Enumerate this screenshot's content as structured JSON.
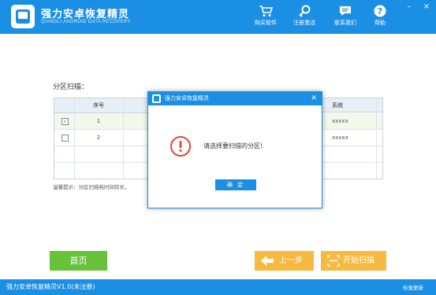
{
  "header": {
    "title": "强力安卓恢复精灵",
    "subtitle": "QIANGLI ANDROID DATA RECOVERY",
    "buttons": [
      {
        "label": "购买软件",
        "icon": "cart-icon"
      },
      {
        "label": "注册激活",
        "icon": "key-icon"
      },
      {
        "label": "联系我们",
        "icon": "chat-icon"
      },
      {
        "label": "帮助",
        "icon": "help-icon"
      }
    ],
    "window_controls": {
      "minimize": "–",
      "close": "×"
    }
  },
  "main": {
    "scan_label": "分区扫描：",
    "table": {
      "columns": [
        "序号",
        "系统"
      ],
      "rows": [
        {
          "checked": true,
          "index": "1",
          "system": "xxxxx"
        },
        {
          "checked": false,
          "index": "2",
          "system": "xxxxx"
        }
      ],
      "check_mark": "✓"
    },
    "tip": "温馨提示：分区扫描耗时间较长，"
  },
  "dialog": {
    "title": "强力安卓恢复精灵",
    "close": "×",
    "message": "请选择要扫描的分区!",
    "ok_label": "确 定"
  },
  "footer_buttons": {
    "home": "首页",
    "prev": "上一步",
    "start": "开始扫描"
  },
  "status_bar": {
    "text": "强力安卓恢复精灵V1.0(未注册)",
    "update": "检查更新"
  },
  "colors": {
    "primary": "#1a8fe4",
    "green": "#67c23a",
    "orange": "#f8b940",
    "warning_red": "#e0463c"
  }
}
